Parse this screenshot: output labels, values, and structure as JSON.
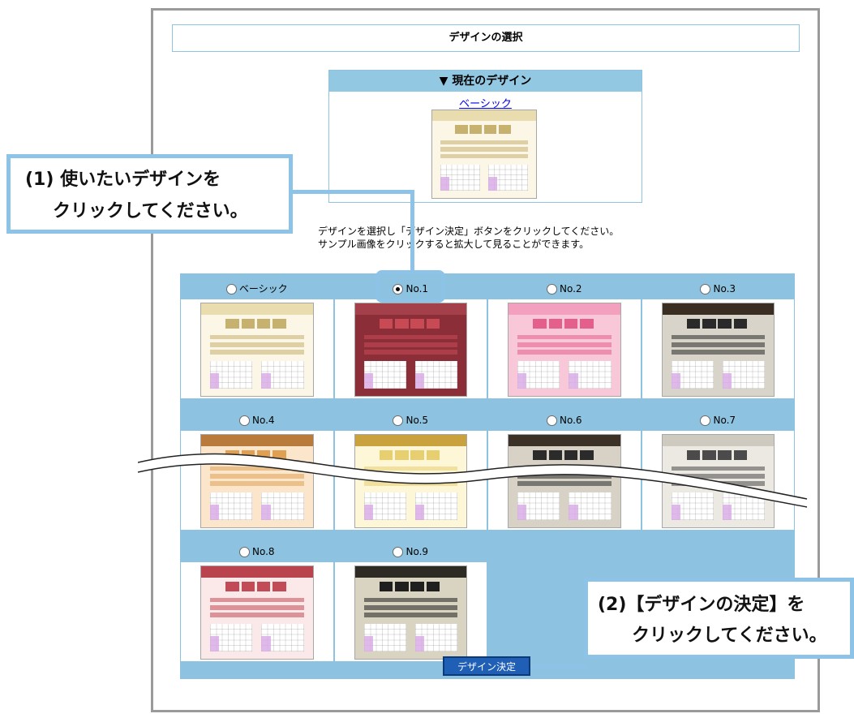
{
  "page_title": "デザインの選択",
  "current_design": {
    "header": "▼ 現在のデザイン",
    "name": "ベーシック"
  },
  "instructions": {
    "line1": "デザインを選択し「デザイン決定」ボタンをクリックしてください。",
    "line2": "サンプル画像をクリックすると拡大して見ることができます。"
  },
  "designs": [
    {
      "label": "ベーシック",
      "selected": false,
      "theme": {
        "bg": "#fbf6e6",
        "head": "#e9dcaf",
        "accent": "#c7b16e"
      }
    },
    {
      "label": "No.1",
      "selected": true,
      "theme": {
        "bg": "#8c2e38",
        "head": "#a3404a",
        "accent": "#c84a55"
      }
    },
    {
      "label": "No.2",
      "selected": false,
      "theme": {
        "bg": "#f9c8d8",
        "head": "#f2a0bd",
        "accent": "#e55f8c"
      }
    },
    {
      "label": "No.3",
      "selected": false,
      "theme": {
        "bg": "#d9d4c9",
        "head": "#3a2e22",
        "accent": "#2a2a2a"
      }
    },
    {
      "label": "No.4",
      "selected": false,
      "theme": {
        "bg": "#fbe6cc",
        "head": "#b97b3c",
        "accent": "#e0a054"
      }
    },
    {
      "label": "No.5",
      "selected": false,
      "theme": {
        "bg": "#fdf7d7",
        "head": "#c9a23e",
        "accent": "#e7ce6f"
      }
    },
    {
      "label": "No.6",
      "selected": false,
      "theme": {
        "bg": "#d7d2c5",
        "head": "#3b3126",
        "accent": "#2b2b2b"
      }
    },
    {
      "label": "No.7",
      "selected": false,
      "theme": {
        "bg": "#ece9e3",
        "head": "#cfcac0",
        "accent": "#4b4b4b"
      }
    },
    {
      "label": "No.8",
      "selected": false,
      "theme": {
        "bg": "#fbe8e8",
        "head": "#b9444e",
        "accent": "#c24b58"
      }
    },
    {
      "label": "No.9",
      "selected": false,
      "theme": {
        "bg": "#d9d3c2",
        "head": "#2e2a24",
        "accent": "#1f1f1f"
      }
    }
  ],
  "submit_button": "デザイン決定",
  "callouts": {
    "first": {
      "line1": "(1) 使いたいデザインを",
      "line2": "クリックしてください。"
    },
    "second": {
      "line1": "(2)【デザインの決定】を",
      "line2": "クリックしてください。"
    }
  },
  "colors": {
    "panel": "#8dc3e0",
    "callout_border": "#8dc3e6",
    "button": "#1f5fb5"
  }
}
